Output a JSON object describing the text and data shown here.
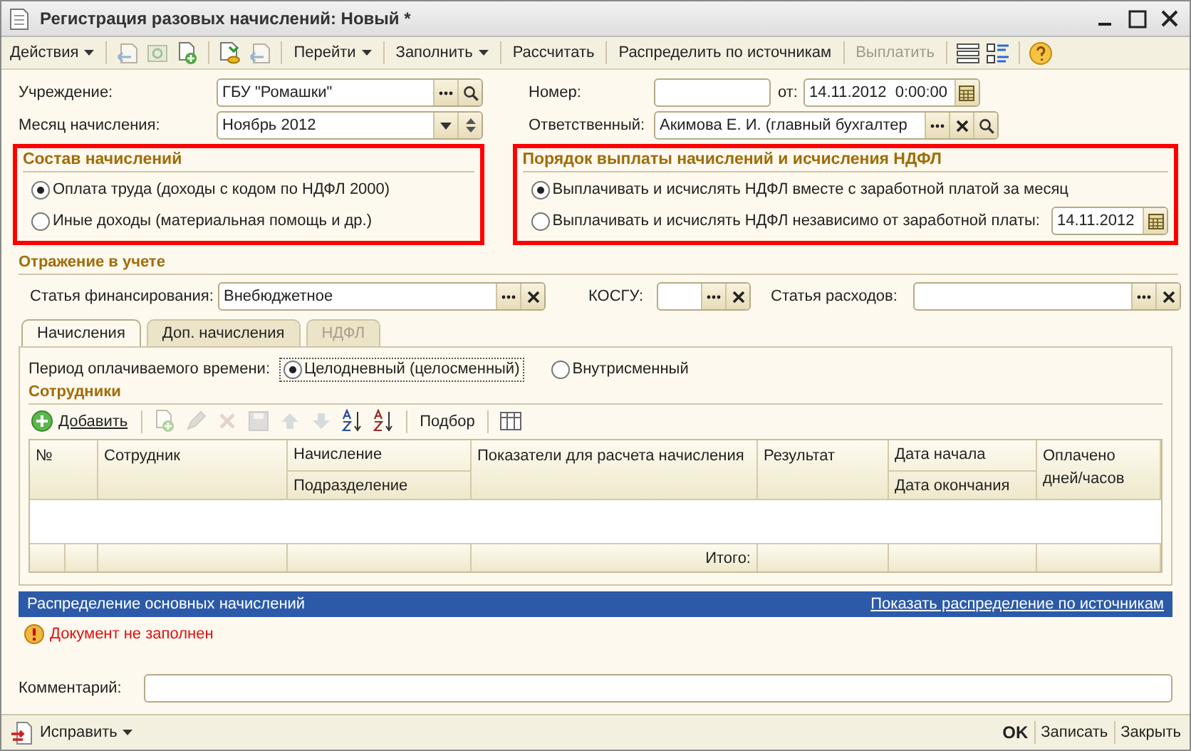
{
  "window": {
    "title": "Регистрация разовых начислений: Новый *"
  },
  "toolbar": [
    {
      "kind": "menu",
      "label": "Действия",
      "disabled": false
    },
    {
      "kind": "separator"
    },
    {
      "kind": "icon",
      "disabled": true
    },
    {
      "kind": "icon",
      "disabled": true
    },
    {
      "kind": "icon",
      "disabled": false
    },
    {
      "kind": "separator"
    },
    {
      "kind": "icon",
      "disabled": false
    },
    {
      "kind": "icon",
      "disabled": true
    },
    {
      "kind": "separator"
    },
    {
      "kind": "menu",
      "label": "Перейти",
      "disabled": false
    },
    {
      "kind": "separator"
    },
    {
      "kind": "menu",
      "label": "Заполнить",
      "disabled": false
    },
    {
      "kind": "separator"
    },
    {
      "kind": "button",
      "label": "Рассчитать",
      "disabled": false
    },
    {
      "kind": "separator"
    },
    {
      "kind": "button",
      "label": "Распределить по источникам",
      "disabled": false
    },
    {
      "kind": "separator"
    },
    {
      "kind": "button",
      "label": "Выплатить",
      "disabled": true
    },
    {
      "kind": "separator"
    },
    {
      "kind": "icon",
      "disabled": false
    },
    {
      "kind": "icon",
      "disabled": false
    },
    {
      "kind": "separator"
    },
    {
      "kind": "icon",
      "disabled": false
    }
  ],
  "header": {
    "organization": {
      "label": "Учреждение:",
      "value": "ГБУ \"Ромашки\""
    },
    "month": {
      "label": "Месяц начисления:",
      "value": "Ноябрь 2012"
    },
    "number": {
      "label": "Номер:"
    },
    "date": {
      "label": "от:",
      "value": "14.11.2012  0:00:00"
    },
    "responsible": {
      "label": "Ответственный:",
      "value": "Акимова Е. И. (главный бухгалтер"
    }
  },
  "composition": {
    "title": "Состав начислений",
    "highlighted": true,
    "options": [
      {
        "label": "Оплата труда (доходы с кодом по НДФЛ 2000)",
        "selected": true
      },
      {
        "label": "Иные доходы (материальная помощь и др.)",
        "selected": false
      }
    ]
  },
  "payment": {
    "title": "Порядок выплаты начислений и исчисления НДФЛ",
    "highlighted": true,
    "options": [
      {
        "label": "Выплачивать и исчислять НДФЛ вместе с заработной платой за месяц",
        "selected": true
      },
      {
        "label": "Выплачивать и исчислять НДФЛ независимо от заработной платы:",
        "selected": false
      }
    ],
    "date": "14.11.2012"
  },
  "accounting": {
    "title": "Отражение в учете",
    "financing": {
      "label": "Статья финансирования:",
      "value": "Внебюджетное"
    },
    "kosgu": {
      "label": "КОСГУ:"
    },
    "expense": {
      "label": "Статья расходов:"
    }
  },
  "tabs": [
    {
      "label": "Начисления",
      "selected": true,
      "disabled": false
    },
    {
      "label": "Доп. начисления",
      "selected": false,
      "disabled": false
    },
    {
      "label": "НДФЛ",
      "selected": false,
      "disabled": true
    }
  ],
  "period": {
    "label": "Период оплачиваемого времени:",
    "options": [
      {
        "label": "Целодневный (целосменный)",
        "selected": true
      },
      {
        "label": "Внутрисменный",
        "selected": false
      }
    ]
  },
  "employees": {
    "title": "Сотрудники",
    "toolbar": [
      {
        "kind": "add",
        "label": "Добавить",
        "disabled": false
      },
      {
        "kind": "separator"
      },
      {
        "kind": "icon",
        "disabled": true
      },
      {
        "kind": "icon",
        "disabled": true
      },
      {
        "kind": "icon",
        "disabled": true
      },
      {
        "kind": "icon",
        "disabled": true
      },
      {
        "kind": "icon",
        "disabled": true
      },
      {
        "kind": "icon",
        "disabled": true
      },
      {
        "kind": "icon",
        "disabled": false
      },
      {
        "kind": "icon",
        "disabled": false
      },
      {
        "kind": "separator"
      },
      {
        "kind": "button",
        "label": "Подбор",
        "disabled": false
      },
      {
        "kind": "separator"
      },
      {
        "kind": "icon",
        "disabled": false
      }
    ],
    "columns": [
      {
        "top": "№"
      },
      {
        "top": "Сотрудник"
      },
      {
        "top": "Начисление",
        "bottom": "Подразделение"
      },
      {
        "top": "Показатели для расчета начисления"
      },
      {
        "top": "Результат"
      },
      {
        "top": "Дата начала",
        "bottom": "Дата окончания"
      },
      {
        "top": "Оплачено дней/часов"
      }
    ],
    "total_label": "Итого:"
  },
  "distribution": {
    "title": "Распределение основных начислений",
    "link": "Показать распределение по источникам"
  },
  "warning": "Документ не заполнен",
  "comment": {
    "label": "Комментарий:"
  },
  "footer": {
    "fix": "Исправить",
    "buttons": [
      {
        "label": "OK",
        "default": true
      },
      {
        "label": "Записать",
        "default": false
      },
      {
        "label": "Закрыть",
        "default": false
      }
    ]
  }
}
